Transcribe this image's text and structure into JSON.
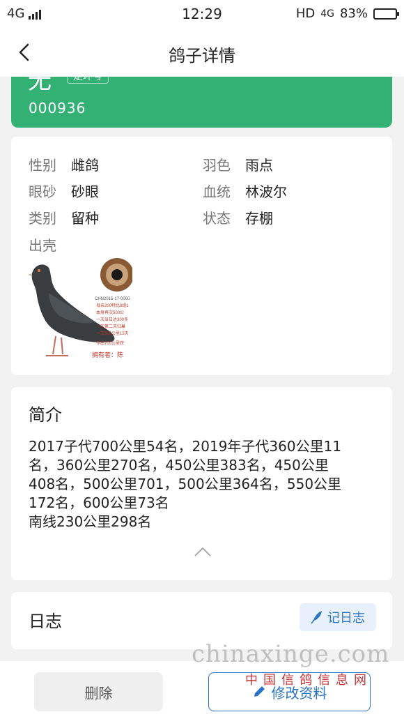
{
  "status_bar": {
    "network": "4G",
    "time": "12:29",
    "hd": "HD",
    "network_right": "4G",
    "battery": "83%",
    "battery_level": 0.83
  },
  "nav": {
    "title": "鸽子详情"
  },
  "pigeon": {
    "name": "无",
    "tag": "足环号",
    "ring_number": "000936"
  },
  "info": {
    "rows": [
      {
        "k": "性别",
        "v": "雌鸽"
      },
      {
        "k": "羽色",
        "v": "雨点"
      },
      {
        "k": "眼砂",
        "v": "砂眼"
      },
      {
        "k": "血统",
        "v": "林波尔"
      },
      {
        "k": "类别",
        "v": "留种"
      },
      {
        "k": "状态",
        "v": "存棚"
      },
      {
        "k": "出壳",
        "v": ""
      }
    ],
    "photo_lines": [
      "CHN2015-17-0000",
      "母亲200特比8组1",
      "本身再次500公",
      "一次当日达300多",
      "一次第二天归巢",
      "一次500公里15天",
      "作出700公里获"
    ],
    "photo_owner": "拥有者：陈"
  },
  "intro": {
    "heading": "简介",
    "text": "2017子代700公里54名，2019年子代360公里11\n名，360公里270名，450公里383名，450公里\n408名，500公里701，500公里364名，550公里\n172名，600公里73名\n南线230公里298名"
  },
  "log": {
    "heading": "日志",
    "button": "记日志"
  },
  "bottom": {
    "delete": "删除",
    "edit": "修改资料"
  },
  "watermark": {
    "site": "chinaxinge.com",
    "cn": "中国信鸽信息网"
  },
  "colors": {
    "accent_green": "#33b074",
    "accent_blue": "#2a74c7"
  }
}
